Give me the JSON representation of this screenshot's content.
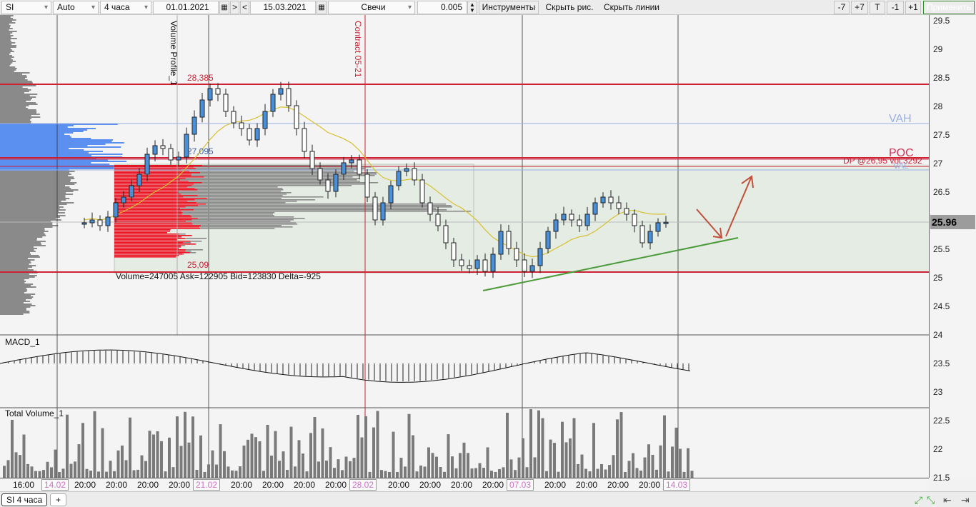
{
  "toolbar": {
    "symbol": "SI",
    "scale": "Auto",
    "timeframe": "4 часа",
    "date_from": "01.01.2021",
    "nav_forward": ">",
    "nav_back": "<",
    "date_to": "15.03.2021",
    "chart_type": "Свечи",
    "step": "0.005",
    "instruments": "Инструменты",
    "hide_drawings": "Скрыть рис.",
    "hide_lines": "Скрыть линии",
    "zoom_buttons": [
      "-7",
      "+7",
      "T",
      "-1",
      "+1"
    ],
    "apply": "Применить"
  },
  "chart_labels": {
    "volume_profile": "Volume Profile_1",
    "contract": "Contract 05-21",
    "level_high": "28,385",
    "level_mid": "27,095",
    "level_low": "25,09",
    "vah": "VAH",
    "poc": "POC",
    "dp": "DP @26,95 vol:3292",
    "val": "VAL",
    "volume_stats": "Volume=247005  Ask=122905  Bid=123830  Delta=-925",
    "macd": "MACD_1",
    "total_volume": "Total Volume_1"
  },
  "price_axis": {
    "ticks": [
      "29.5",
      "29",
      "28.5",
      "28",
      "27.5",
      "27",
      "26.5",
      "26",
      "25.5",
      "25",
      "24.5",
      "24",
      "23.5",
      "23",
      "22.5",
      "22",
      "21.5"
    ],
    "current_price": "25.96"
  },
  "time_axis": {
    "labels": [
      {
        "text": "16:00",
        "highlight": false
      },
      {
        "text": "14.02",
        "highlight": true
      },
      {
        "text": "20:00",
        "highlight": false
      },
      {
        "text": "20:00",
        "highlight": false
      },
      {
        "text": "20:00",
        "highlight": false
      },
      {
        "text": "20:00",
        "highlight": false
      },
      {
        "text": "21.02",
        "highlight": true
      },
      {
        "text": "20:00",
        "highlight": false
      },
      {
        "text": "20:00",
        "highlight": false
      },
      {
        "text": "20:00",
        "highlight": false
      },
      {
        "text": "20:00",
        "highlight": false
      },
      {
        "text": "28.02",
        "highlight": true
      },
      {
        "text": "20:00",
        "highlight": false
      },
      {
        "text": "20:00",
        "highlight": false
      },
      {
        "text": "20:00",
        "highlight": false
      },
      {
        "text": "20:00",
        "highlight": false
      },
      {
        "text": "07.03",
        "highlight": true
      },
      {
        "text": "20:00",
        "highlight": false
      },
      {
        "text": "20:00",
        "highlight": false
      },
      {
        "text": "20:00",
        "highlight": false
      },
      {
        "text": "20:00",
        "highlight": false
      },
      {
        "text": "14.03",
        "highlight": true
      }
    ]
  },
  "tabs": {
    "active": "SI 4 часа",
    "add": "+"
  },
  "colors": {
    "up_candle": "#4a90d9",
    "level_line": "#cc2233",
    "profile_blue": "#5b8ff0",
    "profile_red": "#ee1122",
    "trend_line": "#4a9a3a",
    "arrow": "#c0503a",
    "ma_line": "#d8c030"
  }
}
